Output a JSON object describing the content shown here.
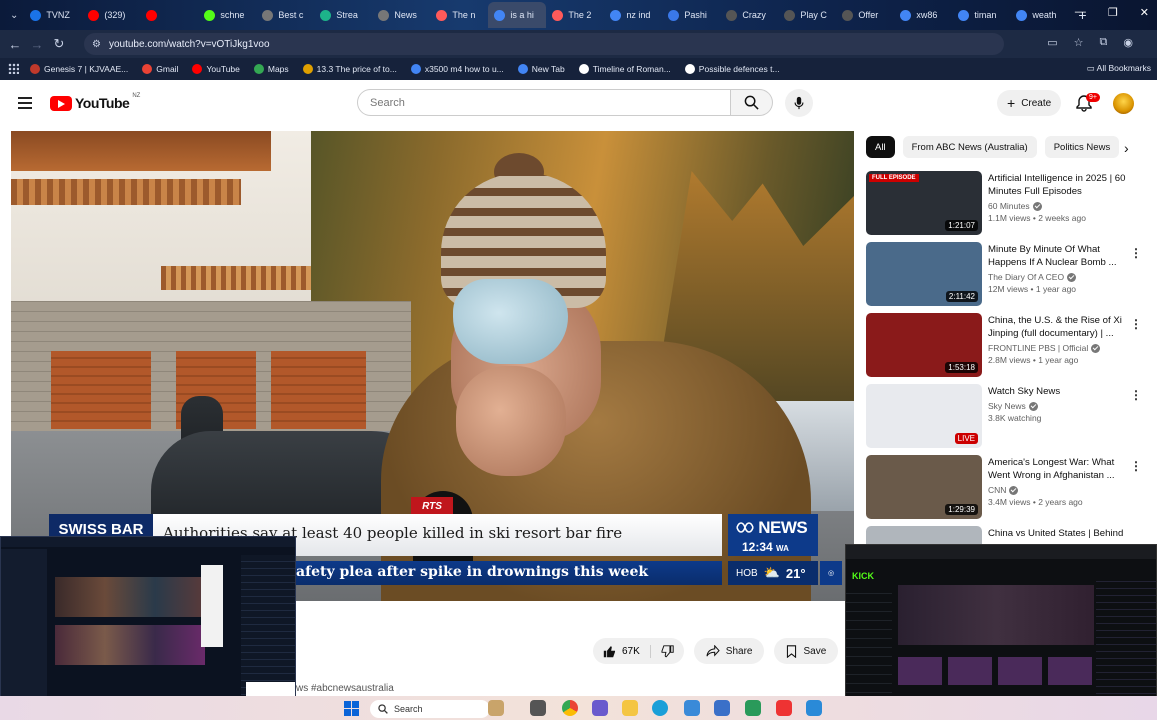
{
  "browser": {
    "tabs": [
      {
        "label": "TVNZ",
        "color": "#1a73e8",
        "active": false
      },
      {
        "label": "(329)",
        "color": "#ff0000",
        "active": false
      },
      {
        "label": "",
        "color": "#ff0000",
        "active": false
      },
      {
        "label": "schne",
        "color": "#53fc18",
        "active": false
      },
      {
        "label": "Best c",
        "color": "#777777",
        "active": false
      },
      {
        "label": "Strea",
        "color": "#1db38a",
        "active": false
      },
      {
        "label": "News",
        "color": "#777777",
        "active": false
      },
      {
        "label": "The n",
        "color": "#ff5a5a",
        "active": false
      },
      {
        "label": "is a hi",
        "color": "#4285f4",
        "active": true
      },
      {
        "label": "The 2",
        "color": "#ff5a5a",
        "active": false
      },
      {
        "label": "nz ind",
        "color": "#4285f4",
        "active": false
      },
      {
        "label": "Pashi",
        "color": "#3a78e8",
        "active": false
      },
      {
        "label": "Crazy",
        "color": "#555555",
        "active": false
      },
      {
        "label": "Play C",
        "color": "#555555",
        "active": false
      },
      {
        "label": "Offer",
        "color": "#555555",
        "active": false
      },
      {
        "label": "xw86",
        "color": "#4285f4",
        "active": false
      },
      {
        "label": "timan",
        "color": "#4285f4",
        "active": false
      },
      {
        "label": "weath",
        "color": "#4285f4",
        "active": false
      }
    ],
    "url": "youtube.com/watch?v=vOTiJkg1voo",
    "bookmarks": [
      {
        "label": "Genesis 7 | KJVAAE...",
        "color": "#c0392b"
      },
      {
        "label": "Gmail",
        "color": "#ea4335"
      },
      {
        "label": "YouTube",
        "color": "#ff0000"
      },
      {
        "label": "Maps",
        "color": "#34a853"
      },
      {
        "label": "13.3 The price of to...",
        "color": "#e0a000"
      },
      {
        "label": "x3500 m4 how to u...",
        "color": "#4285f4"
      },
      {
        "label": "New Tab",
        "color": "#4285f4"
      },
      {
        "label": "Timeline of Roman...",
        "color": "#ffffff"
      },
      {
        "label": "Possible defences t...",
        "color": "#ffffff"
      }
    ],
    "all_bookmarks": "All Bookmarks"
  },
  "youtube": {
    "logo": "YouTube",
    "country": "NZ",
    "search_placeholder": "Search",
    "create": "Create",
    "notif_count": "9+"
  },
  "video": {
    "lower_third_tag": "SWISS BAR",
    "headline": "Authorities say at least 40 people killed in ski resort bar fire",
    "ticker": "afety plea after spike in drownings this week",
    "network": "NEWS",
    "time": "12:34",
    "tz": "WA",
    "location": "HOB",
    "temp": "21°",
    "mic_flag": "RTS"
  },
  "actions": {
    "likes": "67K",
    "share": "Share",
    "save": "Save"
  },
  "hashtag": "ws #abcnewsaustralia",
  "chips": [
    "All",
    "From ABC News (Australia)",
    "Politics News"
  ],
  "recommendations": [
    {
      "title": "Artificial Intelligence in 2025 | 60 Minutes Full Episodes",
      "channel": "60 Minutes",
      "meta": "1.1M views • 2 weeks ago",
      "duration": "1:21:07",
      "tag": "FULL EPISODE",
      "bg": "#2a2f36"
    },
    {
      "title": "Minute By Minute Of What Happens If A Nuclear Bomb ...",
      "channel": "The Diary Of A CEO",
      "meta": "12M views • 1 year ago",
      "duration": "2:11:42",
      "tag": "",
      "bg": "#4a6a8a"
    },
    {
      "title": "China, the U.S. & the Rise of Xi Jinping (full documentary) | ...",
      "channel": "FRONTLINE PBS | Official",
      "meta": "2.8M views • 1 year ago",
      "duration": "1:53:18",
      "tag": "",
      "bg": "#8a1a1a"
    },
    {
      "title": "Watch Sky News",
      "channel": "Sky News",
      "meta": "3.8K watching",
      "duration": "LIVE",
      "tag": "",
      "bg": "#e8eaee"
    },
    {
      "title": "America's Longest War: What Went Wrong in Afghanistan ...",
      "channel": "CNN",
      "meta": "3.4M views • 2 years ago",
      "duration": "1:29:39",
      "tag": "",
      "bg": "#6a5a4a"
    },
    {
      "title": "China vs United States | Behind",
      "channel": "",
      "meta": "",
      "duration": "",
      "tag": "",
      "bg": "#b0b6bc"
    }
  ],
  "taskbar": {
    "search": "Search"
  }
}
